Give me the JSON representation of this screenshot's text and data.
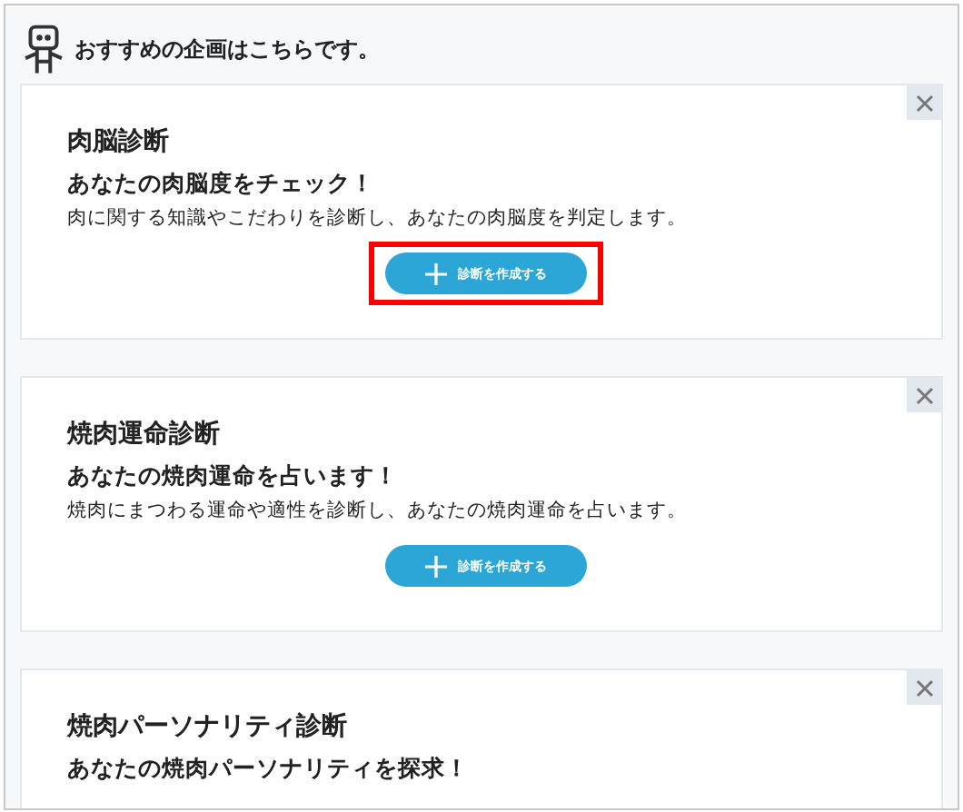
{
  "header": {
    "title": "おすすめの企画はこちらです。"
  },
  "cards": [
    {
      "title": "肉脳診断",
      "subtitle": "あなたの肉脳度をチェック！",
      "description": "肉に関する知識やこだわりを診断し、あなたの肉脳度を判定します。",
      "button": "診断を作成する",
      "highlighted": true
    },
    {
      "title": "焼肉運命診断",
      "subtitle": "あなたの焼肉運命を占います！",
      "description": "焼肉にまつわる運命や適性を診断し、あなたの焼肉運命を占います。",
      "button": "診断を作成する",
      "highlighted": false
    },
    {
      "title": "焼肉パーソナリティ診断",
      "subtitle": "あなたの焼肉パーソナリティを探求！"
    }
  ]
}
